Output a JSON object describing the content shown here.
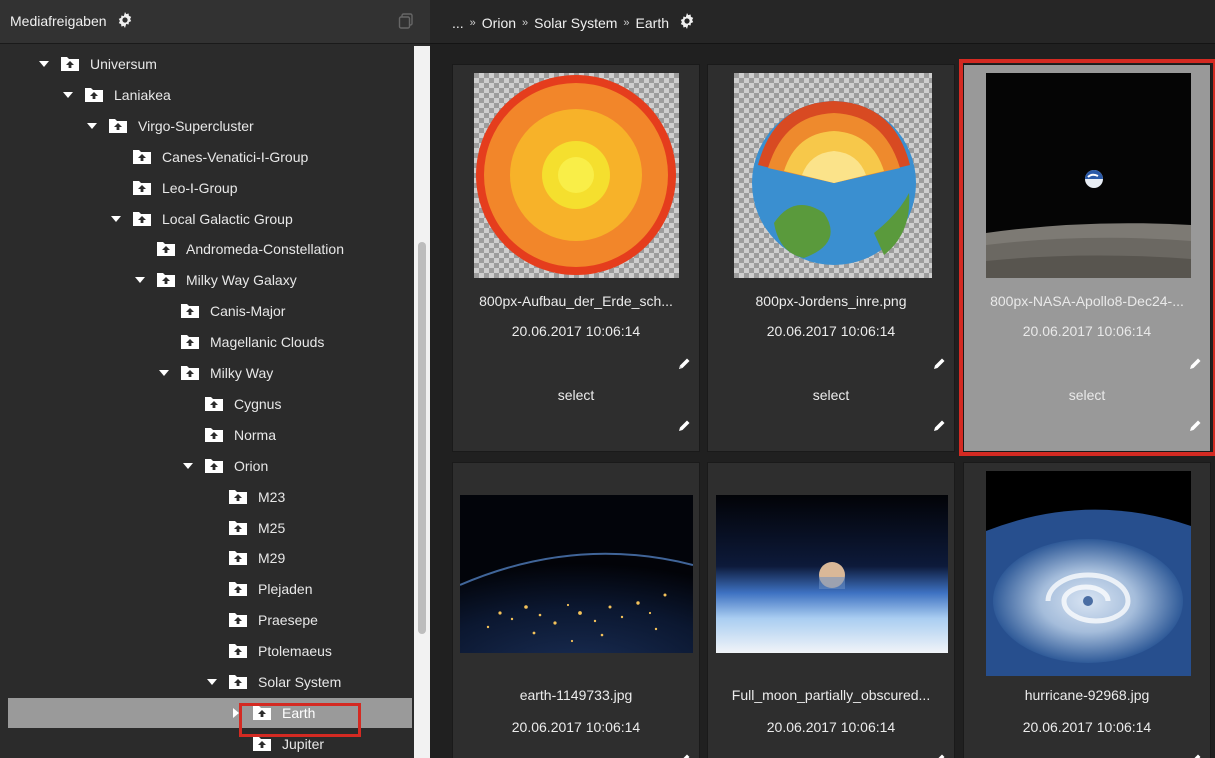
{
  "sidebar": {
    "title": "Mediafreigaben",
    "tree": [
      {
        "label": "Universum",
        "expanded": true,
        "level": 0
      },
      {
        "label": "Laniakea",
        "expanded": true,
        "level": 1
      },
      {
        "label": "Virgo-Supercluster",
        "expanded": true,
        "level": 2
      },
      {
        "label": "Canes-Venatici-I-Group",
        "expanded": false,
        "level": 3
      },
      {
        "label": "Leo-I-Group",
        "expanded": false,
        "level": 3
      },
      {
        "label": "Local Galactic Group",
        "expanded": true,
        "level": 3
      },
      {
        "label": "Andromeda-Constellation",
        "expanded": false,
        "level": 4
      },
      {
        "label": "Milky Way Galaxy",
        "expanded": true,
        "level": 4
      },
      {
        "label": "Canis-Major",
        "expanded": false,
        "level": 5
      },
      {
        "label": "Magellanic Clouds",
        "expanded": false,
        "level": 5
      },
      {
        "label": "Milky Way",
        "expanded": true,
        "level": 5
      },
      {
        "label": "Cygnus",
        "expanded": false,
        "level": 6
      },
      {
        "label": "Norma",
        "expanded": false,
        "level": 6
      },
      {
        "label": "Orion",
        "expanded": true,
        "level": 6
      },
      {
        "label": "M23",
        "expanded": false,
        "level": 7
      },
      {
        "label": "M25",
        "expanded": false,
        "level": 7
      },
      {
        "label": "M29",
        "expanded": false,
        "level": 7
      },
      {
        "label": "Plejaden",
        "expanded": false,
        "level": 7
      },
      {
        "label": "Praesepe",
        "expanded": false,
        "level": 7
      },
      {
        "label": "Ptolemaeus",
        "expanded": false,
        "level": 7
      },
      {
        "label": "Solar System",
        "expanded": true,
        "level": 7
      },
      {
        "label": "Earth",
        "expanded": false,
        "level": 8,
        "selected": true
      },
      {
        "label": "Jupiter",
        "expanded": false,
        "level": 8
      }
    ]
  },
  "breadcrumb": {
    "items": [
      "...",
      "Orion",
      "Solar System",
      "Earth"
    ]
  },
  "media": [
    {
      "name": "800px-Aufbau_der_Erde_sch...",
      "date": "20.06.2017 10:06:14",
      "select_label": "select",
      "thumb": "earth-layers-diagram"
    },
    {
      "name": "800px-Jordens_inre.png",
      "date": "20.06.2017 10:06:14",
      "select_label": "select",
      "thumb": "earth-cutaway"
    },
    {
      "name": "800px-NASA-Apollo8-Dec24-...",
      "date": "20.06.2017 10:06:14",
      "select_label": "select",
      "thumb": "earthrise",
      "selected": true
    },
    {
      "name": "earth-1149733.jpg",
      "date": "20.06.2017 10:06:14",
      "thumb": "earth-night-lights"
    },
    {
      "name": "Full_moon_partially_obscured...",
      "date": "20.06.2017 10:06:14",
      "thumb": "moon-horizon"
    },
    {
      "name": "hurricane-92968.jpg",
      "date": "20.06.2017 10:06:14",
      "thumb": "hurricane"
    }
  ],
  "colors": {
    "highlight_red": "#d42a22",
    "selected_gray": "#999999",
    "panel_dark": "#2b2b2b"
  }
}
